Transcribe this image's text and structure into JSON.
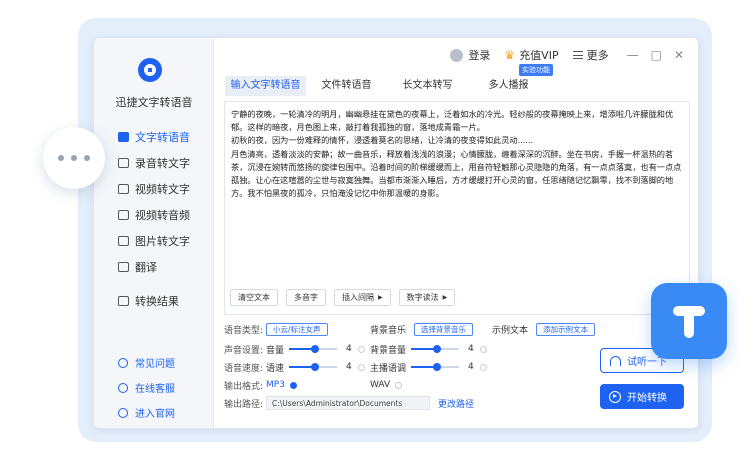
{
  "app": {
    "title": "迅捷文字转语音"
  },
  "topbar": {
    "login": "登录",
    "vip": "充值VIP",
    "more": "更多",
    "min": "—",
    "max": "□",
    "close": "✕"
  },
  "sidebar": {
    "items": [
      {
        "label": "文字转语音"
      },
      {
        "label": "录音转文字"
      },
      {
        "label": "视频转文字"
      },
      {
        "label": "视频转音频"
      },
      {
        "label": "图片转文字"
      },
      {
        "label": "翻译"
      },
      {
        "label": "转换结果"
      }
    ],
    "footer": [
      {
        "label": "常见问题"
      },
      {
        "label": "在线客服"
      },
      {
        "label": "进入官网"
      }
    ]
  },
  "tabs": [
    {
      "label": "输入文字转语音"
    },
    {
      "label": "文件转语音"
    },
    {
      "label": "长文本转写"
    },
    {
      "label": "多人播报",
      "badge": "实验功能"
    }
  ],
  "editor": {
    "paragraphs": [
      "宁静的夜晚，一轮清冷的明月，幽幽悬挂在黛色的夜幕上，泛着如水的冷光。轻纱般的夜幕掩映上来，增添啦几许朦胧和优郁。这样的暗夜，月色图上来，敲打着我孤独的窗，落地成青霜一片。",
      "初秋的夜，因为一份难释的情怀，浸透着莫名的思绪，让冷清的夜变得如此灵动......",
      "月色清亮，透着淡淡的安静；故一曲音乐，释放着浅浅的浪漫；心情朦胧，缠着深深的沉醉。坐在书房，手握一杯温热的茗茶，沉浸在婉转而悠扬的旋律包围中。沿着时间的阶梯缓缓而上，用音符轻触那心灵隐隐的角落，有一点点落寞，也有一点点孤独。让心在这喧嚣的尘世与寂寞独舞。当都市渐渐入睡后，方才缓缓打开心灵的窗，任思绪随记忆飘零，找不到落脚的地方。我不怕黑夜的孤冷，只怕淹没记忆中你那温暖的身影。"
    ],
    "buttons": {
      "clear": "清空文本",
      "polyphone": "多音字",
      "pause": "插入间隔",
      "digits": "数字读法"
    },
    "undo": "⟲",
    "redo": "⟳"
  },
  "settings": {
    "voice_type_label": "语音类型:",
    "voice_type_value": "小云/标注女声",
    "bg_music_label": "背景音乐",
    "bg_music_value": "选择背景音乐",
    "sample_label": "示例文本",
    "sample_value": "添加示例文本",
    "sound_label": "声音设置:",
    "volume_label": "音量",
    "volume_value": "4",
    "volume_fraction": 0.55,
    "bg_volume_label": "背景音量",
    "bg_volume_value": "4",
    "bg_volume_fraction": 0.55,
    "speed_label": "语音速度:",
    "rate_label": "语速",
    "rate_value": "4",
    "rate_fraction": 0.55,
    "pitch_label": "主播语调",
    "pitch_value": "4",
    "pitch_fraction": 0.55,
    "format_label": "输出格式:",
    "format_mp3": "MP3",
    "format_wav": "WAV",
    "path_label": "输出路径:",
    "path_value": "C:\\Users\\Administrator\\Documents",
    "change_path": "更改路径"
  },
  "actions": {
    "listen": "试听一下",
    "start": "开始转换"
  },
  "colors": {
    "accent": "#1d62f0",
    "sidebar_bg": "#f4f6fa",
    "decor_blue": "#3a8af5"
  }
}
